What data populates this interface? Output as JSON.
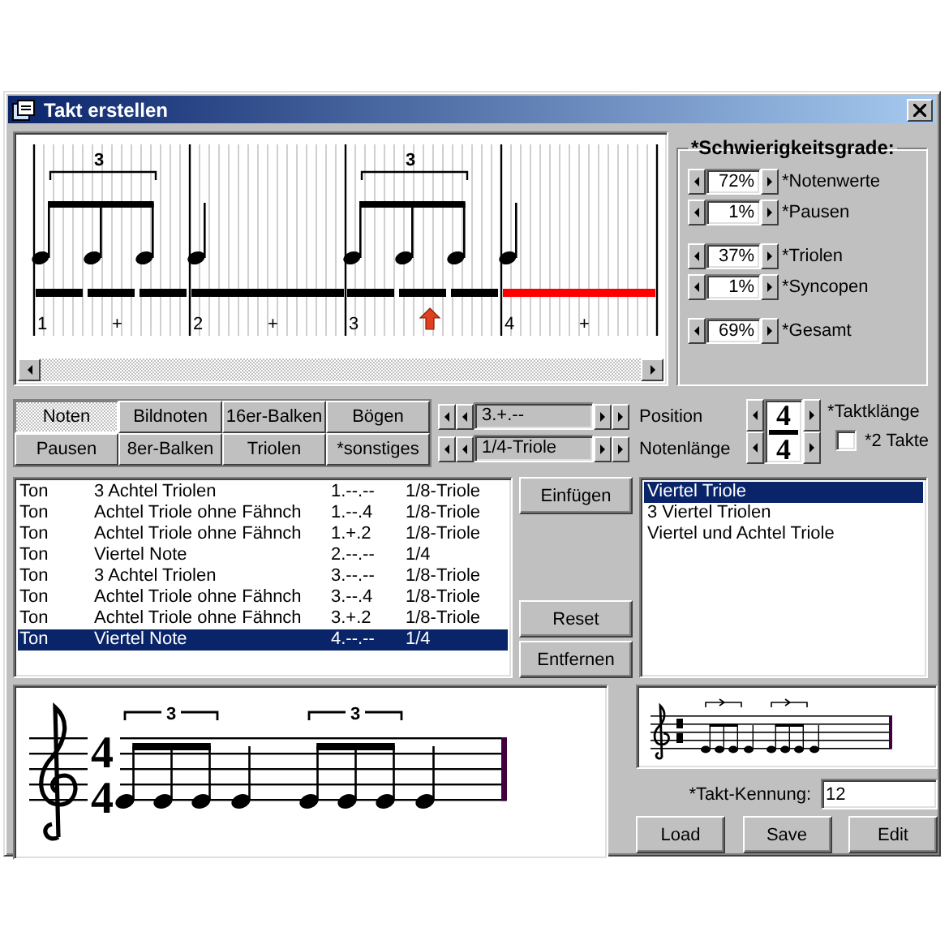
{
  "window": {
    "title": "Takt erstellen"
  },
  "rhythm": {
    "notes": [
      {
        "kind": "triplet",
        "tuplet": "3",
        "selected": false
      },
      {
        "kind": "quarter",
        "selected": false
      },
      {
        "kind": "triplet",
        "tuplet": "3",
        "selected": false
      },
      {
        "kind": "quarter",
        "selected": true
      }
    ],
    "beats": [
      {
        "number": "1",
        "plus": "+",
        "cursor": false
      },
      {
        "number": "2",
        "plus": "+",
        "cursor": false
      },
      {
        "number": "3",
        "cursor": true
      },
      {
        "number": "4",
        "plus": "+",
        "cursor": false
      }
    ]
  },
  "difficulty": {
    "title": "*Schwierigkeitsgrade:",
    "groups": [
      [
        {
          "value": "72%",
          "label": "*Notenwerte"
        },
        {
          "value": "1%",
          "label": "*Pausen"
        }
      ],
      [
        {
          "value": "37%",
          "label": "*Triolen"
        },
        {
          "value": "1%",
          "label": "*Syncopen"
        }
      ],
      [
        {
          "value": "69%",
          "label": "*Gesamt"
        }
      ]
    ]
  },
  "tabs": [
    {
      "label": "Noten",
      "selected": true
    },
    {
      "label": "Bildnoten",
      "selected": false
    },
    {
      "label": "16er-Balken",
      "selected": false
    },
    {
      "label": "Bögen",
      "selected": false
    },
    {
      "label": "Pausen",
      "selected": false
    },
    {
      "label": "8er-Balken",
      "selected": false
    },
    {
      "label": "Triolen",
      "selected": false
    },
    {
      "label": "*sonstiges",
      "selected": false
    }
  ],
  "position": {
    "value": "3.+.--",
    "label": "Position"
  },
  "note_length": {
    "value": "1/4-Triole",
    "label": "Notenlänge"
  },
  "time_signature": {
    "numerator": "4",
    "denominator": "4",
    "label": "*Taktklänge"
  },
  "two_bars": {
    "label": "*2 Takte",
    "checked": false
  },
  "events": [
    {
      "type": "Ton",
      "name": "3 Achtel Triolen",
      "position": "1.--.--",
      "length": "1/8-Triole",
      "selected": false
    },
    {
      "type": "Ton",
      "name": "Achtel Triole ohne Fähnch",
      "position": "1.--.4",
      "length": "1/8-Triole",
      "selected": false
    },
    {
      "type": "Ton",
      "name": "Achtel Triole ohne Fähnch",
      "position": "1.+.2",
      "length": "1/8-Triole",
      "selected": false
    },
    {
      "type": "Ton",
      "name": "Viertel Note",
      "position": "2.--.--",
      "length": "1/4",
      "selected": false
    },
    {
      "type": "Ton",
      "name": "3 Achtel Triolen",
      "position": "3.--.--",
      "length": "1/8-Triole",
      "selected": false
    },
    {
      "type": "Ton",
      "name": "Achtel Triole ohne Fähnch",
      "position": "3.--.4",
      "length": "1/8-Triole",
      "selected": false
    },
    {
      "type": "Ton",
      "name": "Achtel Triole ohne Fähnch",
      "position": "3.+.2",
      "length": "1/8-Triole",
      "selected": false
    },
    {
      "type": "Ton",
      "name": "Viertel Note",
      "position": "4.--.--",
      "length": "1/4",
      "selected": true
    }
  ],
  "buttons": {
    "insert": "Einfügen",
    "reset": "Reset",
    "remove": "Entfernen"
  },
  "presets": [
    {
      "label": "Viertel Triole",
      "selected": true
    },
    {
      "label": "3 Viertel Triolen",
      "selected": false
    },
    {
      "label": "Viertel und Achtel Triole",
      "selected": false
    }
  ],
  "score": {
    "time_signature": [
      "4",
      "4"
    ],
    "notes": [
      {
        "kind": "triplet",
        "tuplet": "3"
      },
      {
        "kind": "quarter"
      },
      {
        "kind": "triplet",
        "tuplet": "3"
      },
      {
        "kind": "quarter"
      }
    ]
  },
  "takt_kennung": {
    "label": "*Takt-Kennung:",
    "value": "12"
  },
  "actions": [
    "Load",
    "Save",
    "Edit"
  ]
}
